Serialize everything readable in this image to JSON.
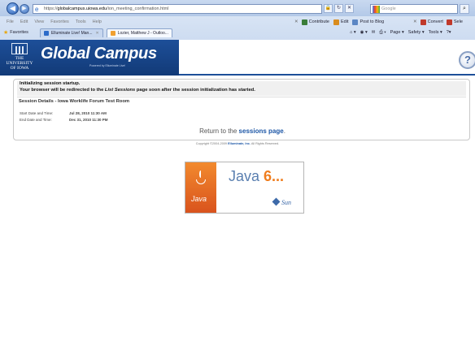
{
  "browser": {
    "url_prefix": "https://",
    "url_domain": "globalcampus.uiowa.edu",
    "url_path": "/ion_meeting_confirmation.html",
    "search_placeholder": "Google",
    "menu": [
      "File",
      "Edit",
      "View",
      "Favorites",
      "Tools",
      "Help"
    ],
    "contribute_label": "Contribute",
    "edit_label": "Edit",
    "post_label": "Post to Blog",
    "convert_label": "Convert",
    "select_label": "Sele",
    "favorites_label": "Favorites",
    "tabs": [
      {
        "label": "Elluminate Live! Man...",
        "active": false
      },
      {
        "label": "Lozier, Matthew J - Outloo...",
        "active": true
      }
    ],
    "command_bar": [
      "Page ▾",
      "Safety ▾",
      "Tools ▾"
    ]
  },
  "header": {
    "university_line1": "THE",
    "university_line2": "UNIVERSITY",
    "university_line3": "OF IOWA",
    "title": "Global Campus",
    "subtitle": "Powered by Elluminate Live!"
  },
  "session": {
    "notice_line1": "Initializing session startup.",
    "notice_line2_pre": "Your browser will be redirected to the ",
    "notice_line2_em": "List Sessions",
    "notice_line2_post": " page soon after the session initialization has started.",
    "details_title": "Session Details - Iowa Worklife Forum Test Room",
    "start_label": "Start Date and Time:",
    "start_value": "Jul 28, 2010 11:30 AM",
    "end_label": "End Date and Time:",
    "end_value": "Dec 31, 2010 11:30 PM",
    "return_pre": "Return to the ",
    "return_link": "sessions page",
    "return_post": "."
  },
  "footer": {
    "copyright_pre": "Copyright ©2004-2009 ",
    "copyright_brand": "Elluminate, Inc.",
    "copyright_post": " All Rights Reserved."
  },
  "java": {
    "logo_word": "Java",
    "version_word": "Java",
    "version_num": "6...",
    "vendor": "Sun"
  }
}
